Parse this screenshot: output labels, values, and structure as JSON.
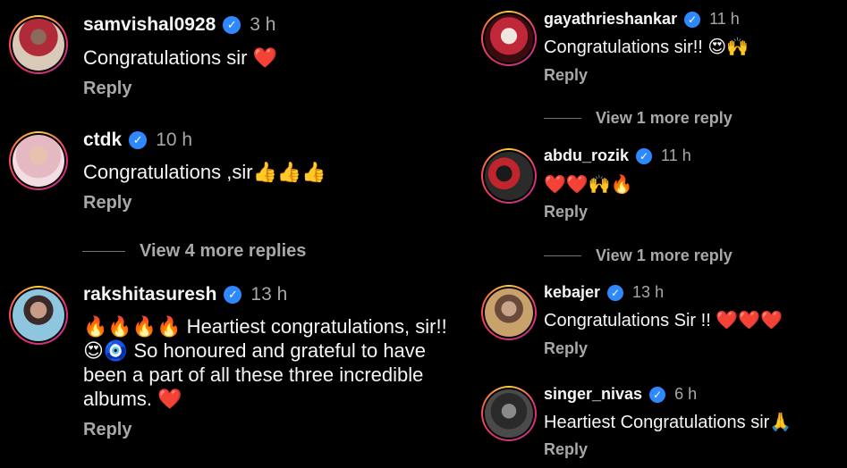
{
  "left": {
    "comments": [
      {
        "username": "samvishal0928",
        "time": "3 h",
        "text": "Congratulations sir ❤️",
        "reply": "Reply"
      },
      {
        "username": "ctdk",
        "time": "10 h",
        "text": "Congratulations ,sir👍👍👍",
        "reply": "Reply"
      },
      {
        "username": "rakshitasuresh",
        "time": "13 h",
        "text": "🔥🔥🔥🔥 Heartiest congratulations, sir!! 😍🧿 So honoured and grateful to have been a part of all these three incredible albums. ❤️",
        "reply": "Reply"
      }
    ],
    "view_more": "View 4 more replies"
  },
  "right": {
    "comments": [
      {
        "username": "gayathrieshankar",
        "time": "11 h",
        "text": "Congratulations sir!! 😍🙌",
        "reply": "Reply"
      },
      {
        "username": "abdu_rozik",
        "time": "11 h",
        "text": "❤️❤️🙌🔥",
        "reply": "Reply"
      },
      {
        "username": "kebajer",
        "time": "13 h",
        "text": "Congratulations Sir !! ❤️❤️❤️",
        "reply": "Reply"
      },
      {
        "username": "singer_nivas",
        "time": "6 h",
        "text": "Heartiest Congratulations sir🙏",
        "reply": "Reply"
      }
    ],
    "view_more_1": "View 1 more reply",
    "view_more_2": "View 1 more reply"
  },
  "verified_icon": "verified-badge-icon",
  "colors": {
    "background": "#000000",
    "text": "#f5f5f5",
    "muted": "#a8a8a8",
    "verified": "#2e89ff",
    "heart": "#ed2b3f"
  }
}
